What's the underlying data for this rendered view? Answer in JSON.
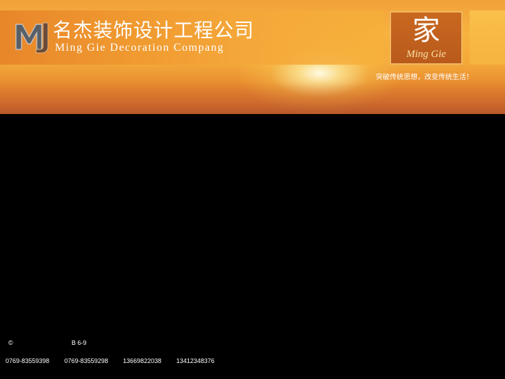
{
  "header": {
    "logo_text": "MJ",
    "company_name": "名杰装饰设计工程公司",
    "company_name_en": "Ming Gie Decoration Compang",
    "home_char": "家",
    "home_caption": "Ming Gie",
    "slogan": "突破传统思想，改变传统生活！"
  },
  "footer": {
    "copyright": "©",
    "address": "B 6-9",
    "phones": [
      "0769-83559398",
      "0769-83559298",
      "13669822038",
      "13412348376"
    ]
  },
  "colors": {
    "banner_orange": "#f4a93a",
    "background": "#000000",
    "text": "#ffffff"
  }
}
